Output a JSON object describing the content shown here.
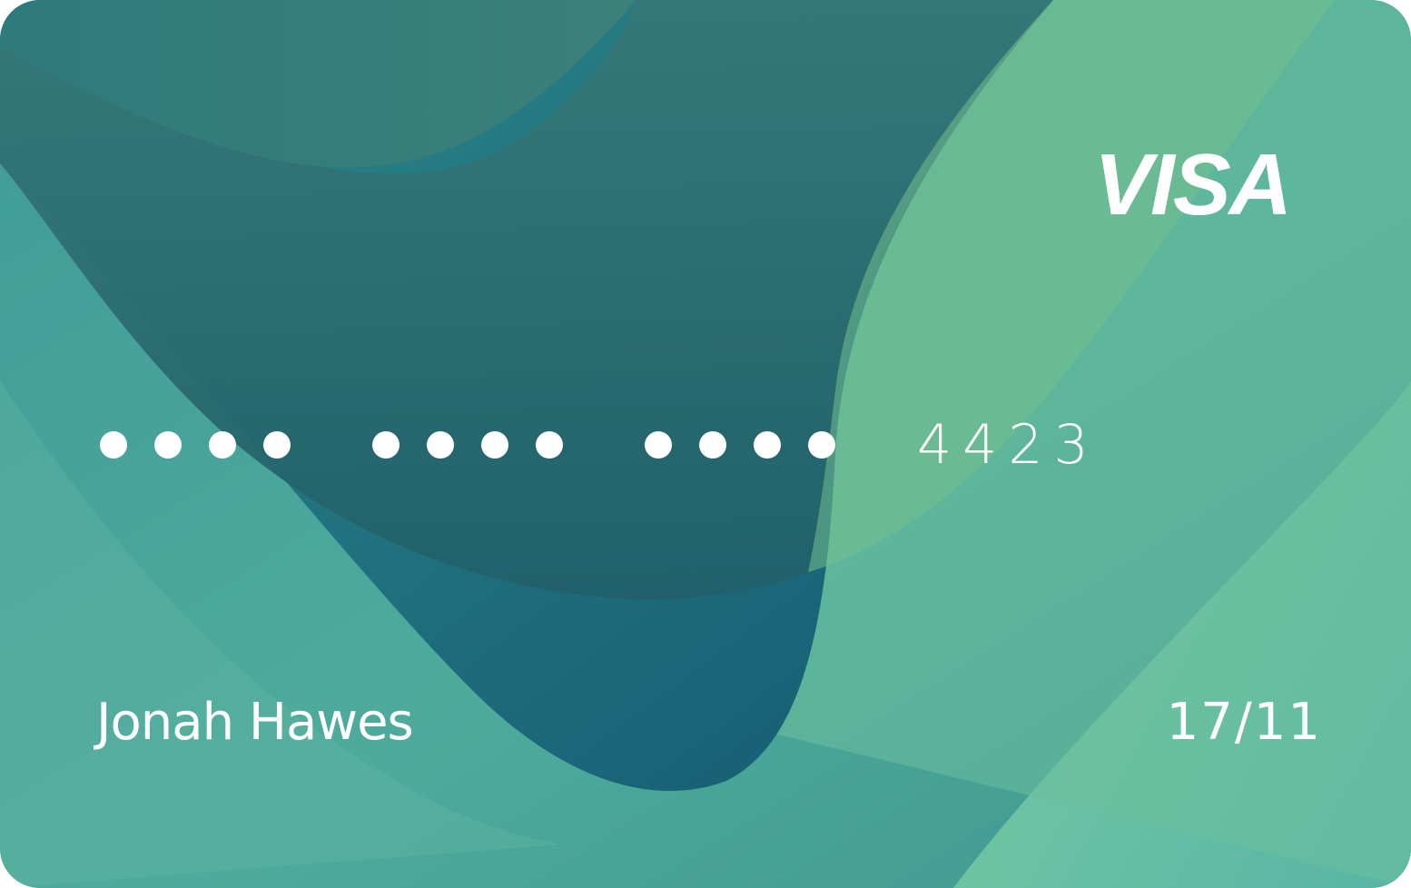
{
  "card": {
    "brand": "VISA",
    "masked_groups": [
      4,
      4,
      4
    ],
    "last4": "4423",
    "holder_name": "Jonah Hawes",
    "expiry": "17/11"
  },
  "colors": {
    "text": "#ffffff",
    "teal_dark": "#1d5a6a",
    "teal": "#2e8b8a",
    "mint": "#6fc6a4",
    "green_light": "#8ad39a"
  }
}
